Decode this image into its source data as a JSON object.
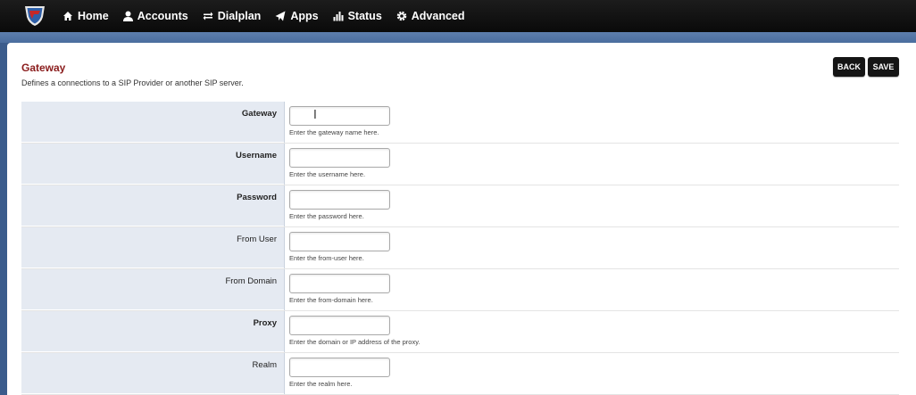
{
  "nav": {
    "items": [
      {
        "label": "Home",
        "icon": "home-icon"
      },
      {
        "label": "Accounts",
        "icon": "user-icon"
      },
      {
        "label": "Dialplan",
        "icon": "arrows-icon"
      },
      {
        "label": "Apps",
        "icon": "paper-plane-icon"
      },
      {
        "label": "Status",
        "icon": "bar-chart-icon"
      },
      {
        "label": "Advanced",
        "icon": "gear-icon"
      }
    ]
  },
  "page": {
    "title": "Gateway",
    "description": "Defines a connections to a SIP Provider or another SIP server.",
    "back_label": "BACK",
    "save_label": "SAVE"
  },
  "fields": [
    {
      "label": "Gateway",
      "hint": "Enter the gateway name here.",
      "value": ""
    },
    {
      "label": "Username",
      "hint": "Enter the username here.",
      "value": ""
    },
    {
      "label": "Password",
      "hint": "Enter the password here.",
      "value": ""
    },
    {
      "label": "From User",
      "hint": "Enter the from-user here.",
      "value": ""
    },
    {
      "label": "From Domain",
      "hint": "Enter the from-domain here.",
      "value": ""
    },
    {
      "label": "Proxy",
      "hint": "Enter the domain or IP address of the proxy.",
      "value": ""
    },
    {
      "label": "Realm",
      "hint": "Enter the realm here.",
      "value": ""
    }
  ]
}
